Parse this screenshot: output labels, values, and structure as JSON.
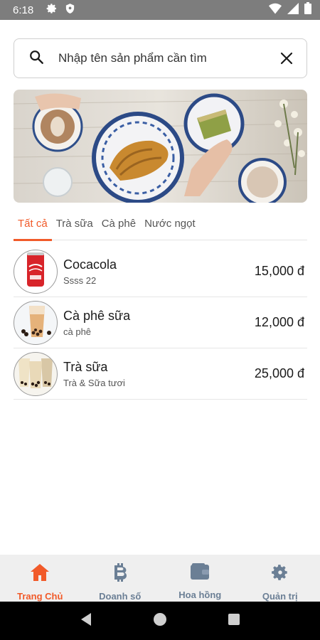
{
  "status_bar": {
    "time": "6:18",
    "left_icons": [
      "gear-icon",
      "shield-icon"
    ],
    "right_icons": [
      "wifi-icon",
      "signal-icon",
      "battery-icon"
    ]
  },
  "search": {
    "placeholder": "Nhập tên sản phẩm cần tìm",
    "value": ""
  },
  "tabs": [
    {
      "label": "Tất cả",
      "active": true
    },
    {
      "label": "Trà sữa",
      "active": false
    },
    {
      "label": "Cà phê",
      "active": false
    },
    {
      "label": "Nước ngọt",
      "active": false
    }
  ],
  "products": [
    {
      "name": "Cocacola",
      "category": "Ssss 22",
      "price": "15,000 đ",
      "thumb_icon": "cola-can-icon"
    },
    {
      "name": "Cà phê sữa",
      "category": "cà phê",
      "price": "12,000 đ",
      "thumb_icon": "coffee-cup-icon"
    },
    {
      "name": "Trà sữa",
      "category": "Trà & Sữa tươi",
      "price": "25,000 đ",
      "thumb_icon": "milk-tea-icon"
    }
  ],
  "bottom_nav": [
    {
      "label": "Trang Chủ",
      "icon": "home-icon",
      "active": true
    },
    {
      "label": "Doanh số",
      "icon": "bitcoin-icon",
      "active": false
    },
    {
      "label": "Hoa hồng",
      "icon": "wallet-icon",
      "active": false
    },
    {
      "label": "Quản trị",
      "icon": "gear-icon",
      "active": false
    }
  ],
  "colors": {
    "accent": "#f15a29",
    "nav_inactive": "#6b7f95",
    "status_bar": "#7d7d7d"
  }
}
